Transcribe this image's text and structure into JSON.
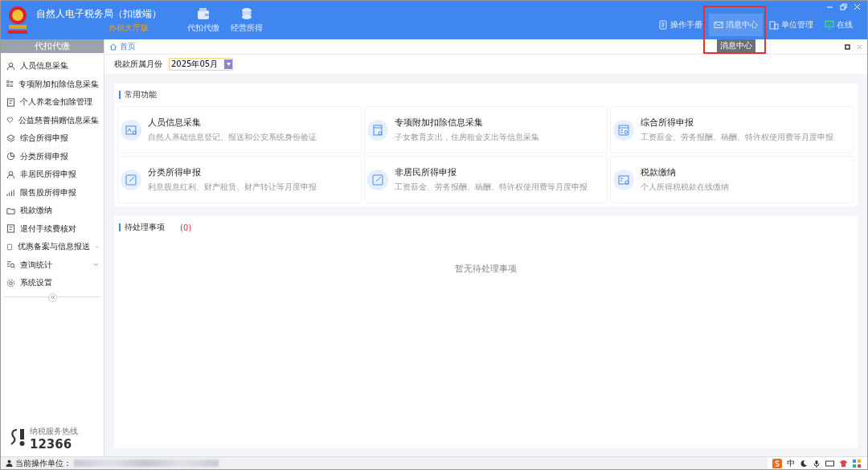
{
  "app": {
    "title": "自然人电子税务局（扣缴端）",
    "edition": "办税大厅版"
  },
  "top_nav": [
    {
      "label": "代扣代缴",
      "kind": "wallet"
    },
    {
      "label": "经营所得",
      "kind": "coins"
    }
  ],
  "toolbar": [
    {
      "label": "操作手册",
      "kind": "manual",
      "selected": false
    },
    {
      "label": "消息中心",
      "kind": "message",
      "selected": true
    },
    {
      "label": "单位管理",
      "kind": "unit",
      "selected": false
    },
    {
      "label": "在线",
      "kind": "online",
      "selected": false
    }
  ],
  "tooltip": "消息中心",
  "sidebar": {
    "title": "代扣代缴",
    "items": [
      {
        "label": "人员信息采集",
        "kind": "person",
        "submenu": false
      },
      {
        "label": "专项附加扣除信息采集",
        "kind": "list",
        "submenu": false
      },
      {
        "label": "个人养老金扣除管理",
        "kind": "doc",
        "submenu": false
      },
      {
        "label": "公益慈善捐赠信息采集",
        "kind": "heart",
        "submenu": false
      },
      {
        "label": "综合所得申报",
        "kind": "layers",
        "submenu": false
      },
      {
        "label": "分类所得申报",
        "kind": "pie",
        "submenu": false
      },
      {
        "label": "非居民所得申报",
        "kind": "person",
        "submenu": false
      },
      {
        "label": "限售股所得申报",
        "kind": "chart",
        "submenu": false
      },
      {
        "label": "税款缴纳",
        "kind": "folder",
        "submenu": false
      },
      {
        "label": "退付手续费核对",
        "kind": "doc",
        "submenu": false
      },
      {
        "label": "优惠备案与信息报送",
        "kind": "page",
        "submenu": true
      },
      {
        "label": "查询统计",
        "kind": "search",
        "submenu": true
      },
      {
        "label": "系统设置",
        "kind": "gear",
        "submenu": false
      }
    ]
  },
  "breadcrumb": "首页",
  "period": {
    "label": "税款所属月份",
    "value": "2025年05月"
  },
  "common": {
    "title": "常用功能",
    "cards": [
      {
        "title": "人员信息采集",
        "desc": "自然人基础信息登记、报送和公安系统身份验证",
        "kind": "idcard"
      },
      {
        "title": "专项附加扣除信息采集",
        "desc": "子女教育支出，住房租金支出等信息采集",
        "kind": "calendar"
      },
      {
        "title": "综合所得申报",
        "desc": "工资薪金、劳务报酬、稿酬、特许权使用费等月度申报",
        "kind": "form"
      },
      {
        "title": "分类所得申报",
        "desc": "利息股息红利、财产租赁、财产转让等月度申报",
        "kind": "edit"
      },
      {
        "title": "非居民所得申报",
        "desc": "工资薪金、劳务报酬、稿酬、特许权使用费等月度申报",
        "kind": "edit"
      },
      {
        "title": "税款缴纳",
        "desc": "个人所得税税款在线缴纳",
        "kind": "pay"
      }
    ]
  },
  "pending": {
    "title": "待处理事项",
    "count": "(0)",
    "empty": "暂无待处理事项"
  },
  "hotline": {
    "label": "纳税服务热线",
    "number": "12366"
  },
  "status_bar": {
    "label": "当前操作单位："
  },
  "tray": {
    "ime": "中"
  }
}
